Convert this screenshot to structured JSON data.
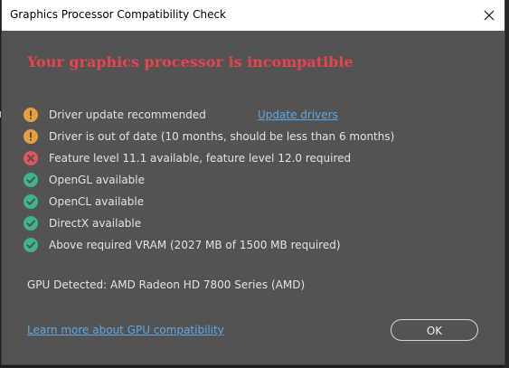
{
  "window": {
    "title": "Graphics Processor Compatibility Check"
  },
  "heading": "Your graphics processor is incompatible",
  "checks": [
    {
      "label": "Driver update recommended",
      "status": "warning",
      "icon": "warning-icon"
    },
    {
      "label": "Driver is out of date (10 months, should be less than 6 months)",
      "status": "warning",
      "icon": "warning-icon"
    },
    {
      "label": "Feature level 11.1 available, feature level 12.0 required",
      "status": "error",
      "icon": "error-icon"
    },
    {
      "label": "OpenGL available",
      "status": "ok",
      "icon": "check-icon"
    },
    {
      "label": "OpenCL available",
      "status": "ok",
      "icon": "check-icon"
    },
    {
      "label": "DirectX available",
      "status": "ok",
      "icon": "check-icon"
    },
    {
      "label": "Above required VRAM (2027 MB of 1500 MB required)",
      "status": "ok",
      "icon": "check-icon"
    }
  ],
  "update_link": "Update drivers",
  "gpu_detected": "GPU Detected: AMD Radeon HD 7800 Series (AMD)",
  "learn_more_link": "Learn more about GPU compatibility",
  "ok_button": "OK",
  "colors": {
    "warning": "#e5a03c",
    "error": "#e0585d",
    "ok": "#3fb58a",
    "heading": "#e8434d",
    "link": "#5aa7e8",
    "dialog_bg": "#535353"
  }
}
